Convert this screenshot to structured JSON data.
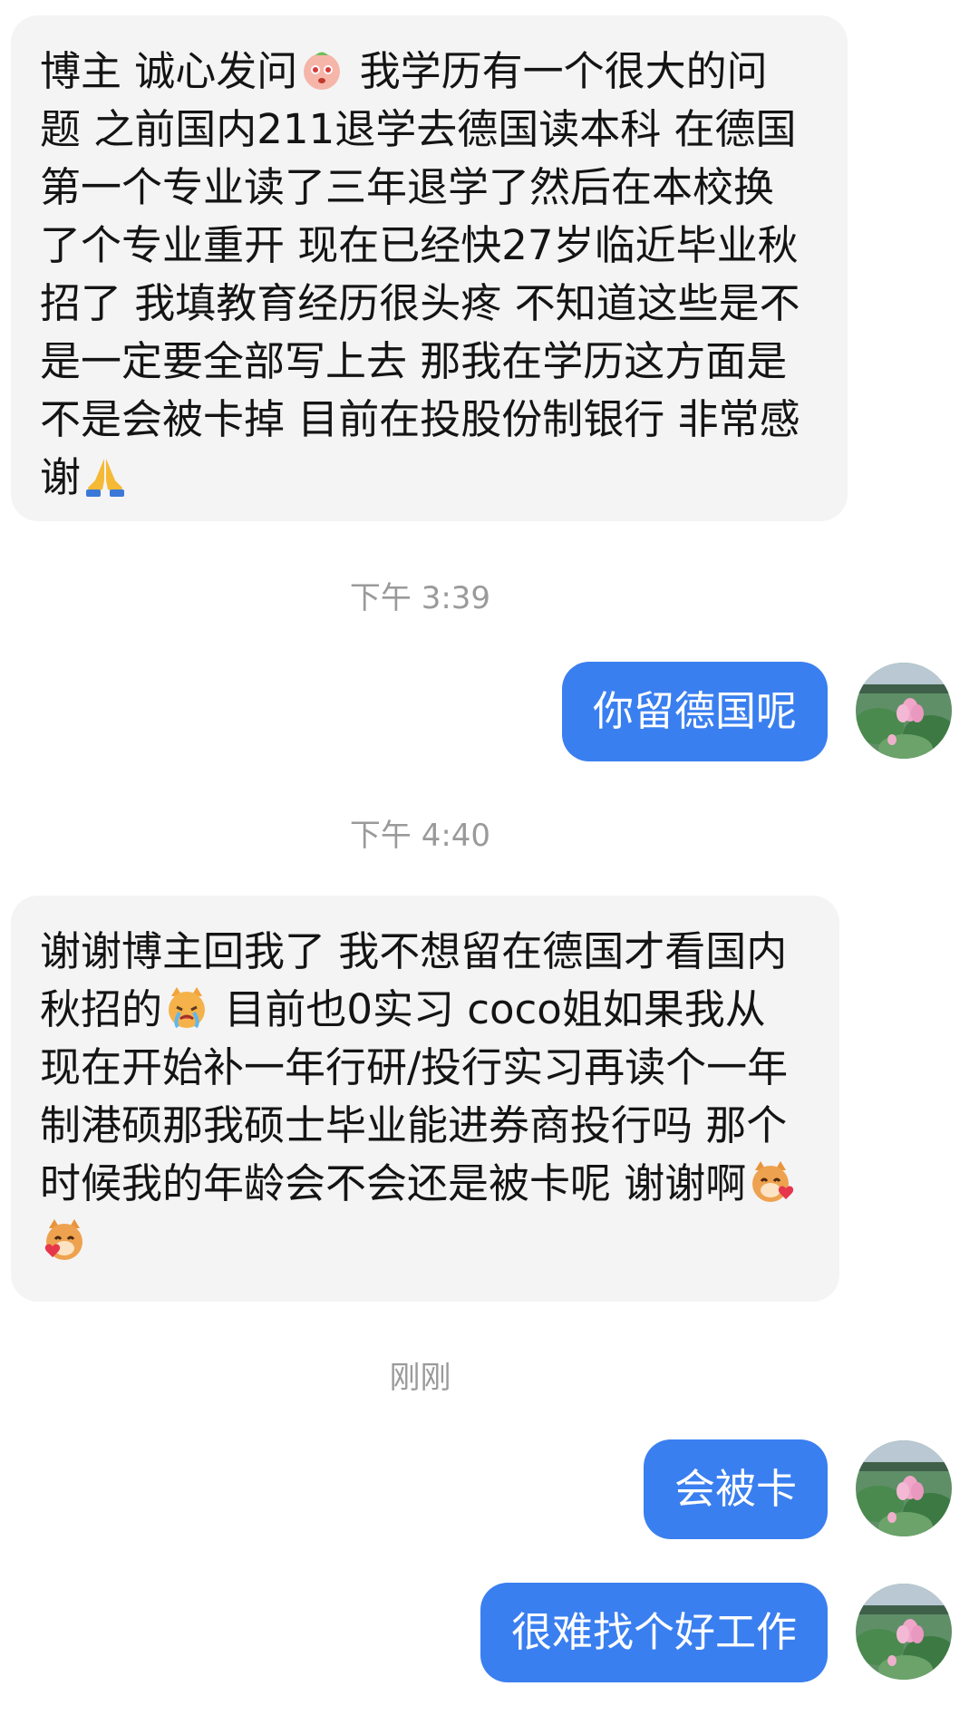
{
  "messages": [
    {
      "lines": [
        "博主 诚心发问",
        " 我学历有一个很大的问",
        "题 之前国内211退学去德国读本科 在德国",
        "第一个专业读了三年退学了然后在本校换",
        "了个专业重开 现在已经快27岁临近毕业秋",
        "招了 我填教育经历很头疼 不知道这些是不",
        "是一定要全部写上去 那我在学历这方面是",
        "不是会被卡掉 目前在投股份制银行 非常感",
        "谢"
      ]
    },
    {
      "timestamp": "下午 3:39"
    },
    {
      "text": "你留德国呢"
    },
    {
      "timestamp": "下午 4:40"
    },
    {
      "lines": [
        "谢谢博主回我了 我不想留在德国才看国内",
        "秋招的",
        " 目前也0实习 coco姐如果我从",
        "现在开始补一年行研/投行实习再读个一年",
        "制港硕那我硕士毕业能进券商投行吗 那个",
        "时候我的年龄会不会还是被卡呢 谢谢啊"
      ]
    },
    {
      "timestamp": "刚刚"
    },
    {
      "text": "会被卡"
    },
    {
      "text": "很难找个好工作"
    }
  ],
  "emoji": {
    "blush": "blush-face-emoji",
    "pray": "praying-hands-emoji",
    "cat_cry": "crying-cat-emoji",
    "cat_heart": "cat-heart-emoji"
  },
  "colors": {
    "incoming_bubble": "#f4f4f5",
    "outgoing_bubble": "#3a7ff0",
    "timestamp": "#9a9a9a"
  }
}
